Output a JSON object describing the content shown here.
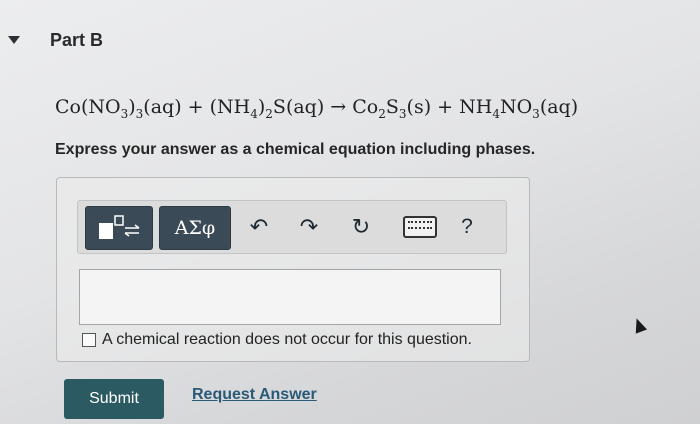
{
  "part": {
    "title": "Part B"
  },
  "equation": {
    "t1": "Co(NO",
    "s1": "3",
    "t2": ")",
    "s2": "3",
    "t3": "(aq) + (NH",
    "s3": "4",
    "t4": ")",
    "s4": "2",
    "t5": "S(aq) → Co",
    "s5": "2",
    "t6": "S",
    "s6": "3",
    "t7": "(s) + NH",
    "s7": "4",
    "t8": "NO",
    "s8": "3",
    "t9": "(aq)"
  },
  "instruction": "Express your answer as a chemical equation including phases.",
  "toolbar": {
    "symbols_label": "ΑΣφ",
    "undo_glyph": "↶",
    "redo_glyph": "↷",
    "reset_glyph": "↻",
    "help_label": "?"
  },
  "answer": {
    "value": "",
    "placeholder": ""
  },
  "no_reaction_label": "A chemical reaction does not occur for this question.",
  "submit_label": "Submit",
  "request_answer_label": "Request Answer",
  "colors": {
    "submit": "#2c5a63",
    "toolbar_dark": "#3a4a56",
    "link": "#2a5a78"
  }
}
